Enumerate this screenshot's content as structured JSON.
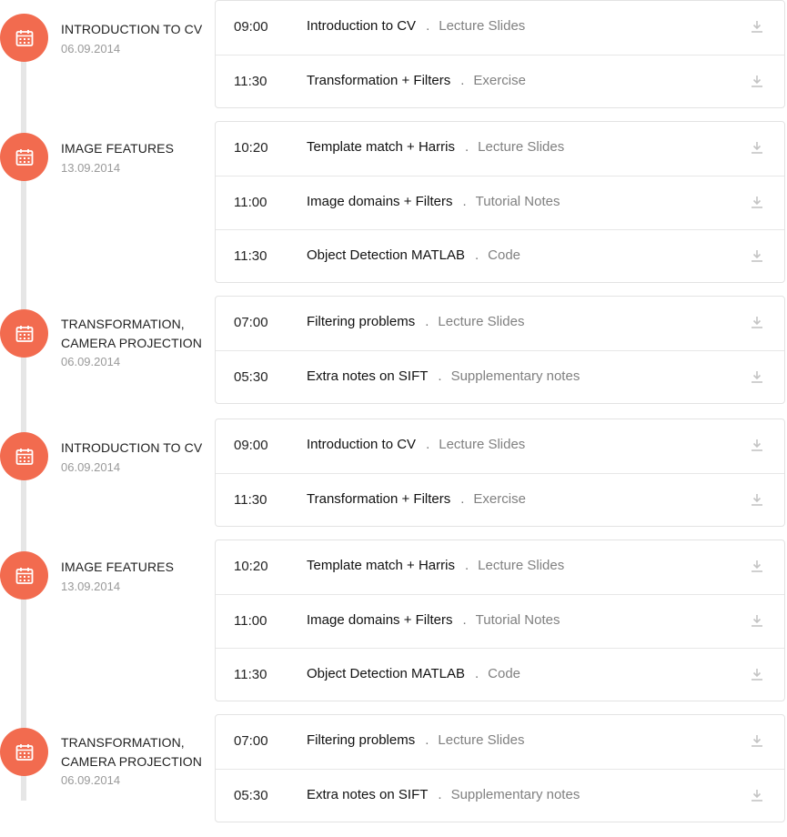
{
  "days": [
    {
      "title": "INTRODUCTION TO CV",
      "date": "06.09.2014",
      "sessions": [
        {
          "time": "09:00",
          "title": "Introduction to CV",
          "type": "Lecture Slides"
        },
        {
          "time": "11:30",
          "title": "Transformation + Filters",
          "type": "Exercise"
        }
      ]
    },
    {
      "title": "IMAGE FEATURES",
      "date": "13.09.2014",
      "sessions": [
        {
          "time": "10:20",
          "title": "Template match + Harris",
          "type": "Lecture Slides"
        },
        {
          "time": "11:00",
          "title": "Image domains + Filters",
          "type": "Tutorial Notes"
        },
        {
          "time": "11:30",
          "title": "Object Detection MATLAB",
          "type": "Code"
        }
      ]
    },
    {
      "title": "TRANSFORMATION,\nCAMERA PROJECTION",
      "date": "06.09.2014",
      "sessions": [
        {
          "time": "07:00",
          "title": "Filtering problems",
          "type": "Lecture Slides"
        },
        {
          "time": "05:30",
          "title": "Extra notes on SIFT",
          "type": "Supplementary notes"
        }
      ]
    },
    {
      "title": "INTRODUCTION TO CV",
      "date": "06.09.2014",
      "sessions": [
        {
          "time": "09:00",
          "title": "Introduction to CV",
          "type": "Lecture Slides"
        },
        {
          "time": "11:30",
          "title": "Transformation + Filters",
          "type": "Exercise"
        }
      ]
    },
    {
      "title": "IMAGE FEATURES",
      "date": "13.09.2014",
      "sessions": [
        {
          "time": "10:20",
          "title": "Template match + Harris",
          "type": "Lecture Slides"
        },
        {
          "time": "11:00",
          "title": "Image domains + Filters",
          "type": "Tutorial Notes"
        },
        {
          "time": "11:30",
          "title": "Object Detection MATLAB",
          "type": "Code"
        }
      ]
    },
    {
      "title": "TRANSFORMATION,\nCAMERA PROJECTION",
      "date": "06.09.2014",
      "sessions": [
        {
          "time": "07:00",
          "title": "Filtering problems",
          "type": "Lecture Slides"
        },
        {
          "time": "05:30",
          "title": "Extra notes on SIFT",
          "type": "Supplementary notes"
        }
      ]
    }
  ],
  "separator": ".",
  "icons": {
    "day_badge": "calendar-icon",
    "session_action": "download-icon"
  },
  "colors": {
    "badge": "#f26b4f",
    "timeline": "#e6e6e6",
    "secondary_text": "#808080",
    "date": "#9a9a9a"
  }
}
